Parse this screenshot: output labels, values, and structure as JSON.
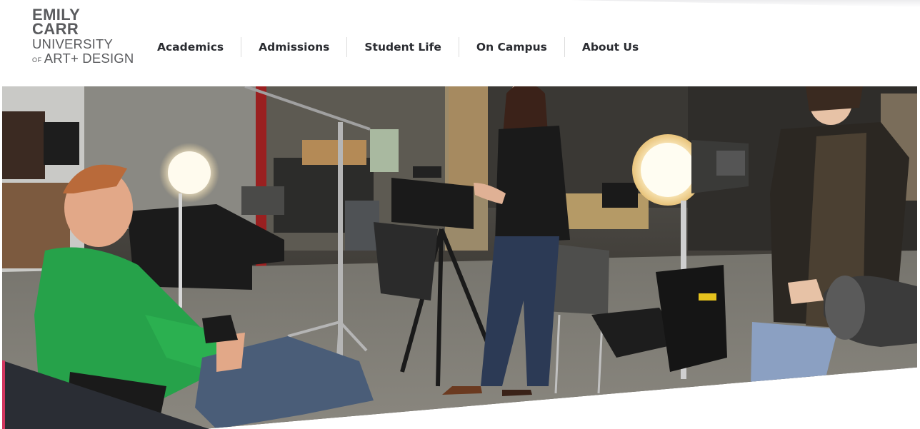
{
  "brand": {
    "line1": "EMILY",
    "line2": "CARR",
    "line3": "UNIVERSITY",
    "of": "OF",
    "line4": "ART+ DESIGN"
  },
  "nav": {
    "items": [
      {
        "label": "Academics"
      },
      {
        "label": "Admissions"
      },
      {
        "label": "Student Life"
      },
      {
        "label": "On Campus"
      },
      {
        "label": "About Us"
      }
    ]
  },
  "colors": {
    "text": "#2a2c31",
    "logo": "#5a5b5e",
    "accent": "#d2365f",
    "band": "#2a2d34"
  }
}
